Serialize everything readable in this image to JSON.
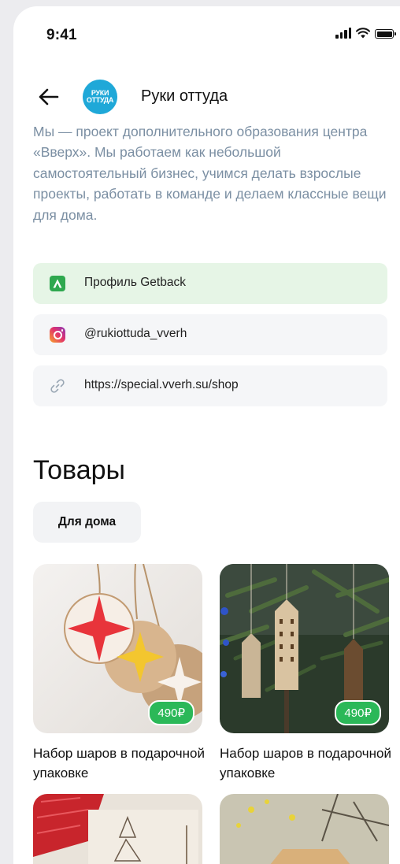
{
  "status_bar": {
    "time": "9:41"
  },
  "header": {
    "logo_text_top": "РУКИ",
    "logo_text_bottom": "ОТТУДА",
    "shop_name": "Руки оттуда"
  },
  "description": "Мы — проект дополнительного образования центра «Вверх». Мы работаем как небольшой самостоятельный бизнес, учимся делать взрослые проекты, работать в команде и делаем классные вещи для дома.",
  "links": [
    {
      "label": "Профиль Getback",
      "icon": "getback-icon"
    },
    {
      "label": "@rukiottuda_vverh",
      "icon": "instagram-icon"
    },
    {
      "label": "https://special.vverh.su/shop",
      "icon": "link-icon"
    }
  ],
  "products_section": {
    "title": "Товары",
    "filter_chip": "Для дома"
  },
  "products": [
    {
      "title": "Набор шаров в подарочной упаковке",
      "price": "490₽"
    },
    {
      "title": "Набор шаров в подарочной упаковке",
      "price": "490₽"
    }
  ],
  "colors": {
    "accent_green": "#2BB858",
    "description_text": "#7B8FA3",
    "logo_blue": "#1FA8D8"
  }
}
